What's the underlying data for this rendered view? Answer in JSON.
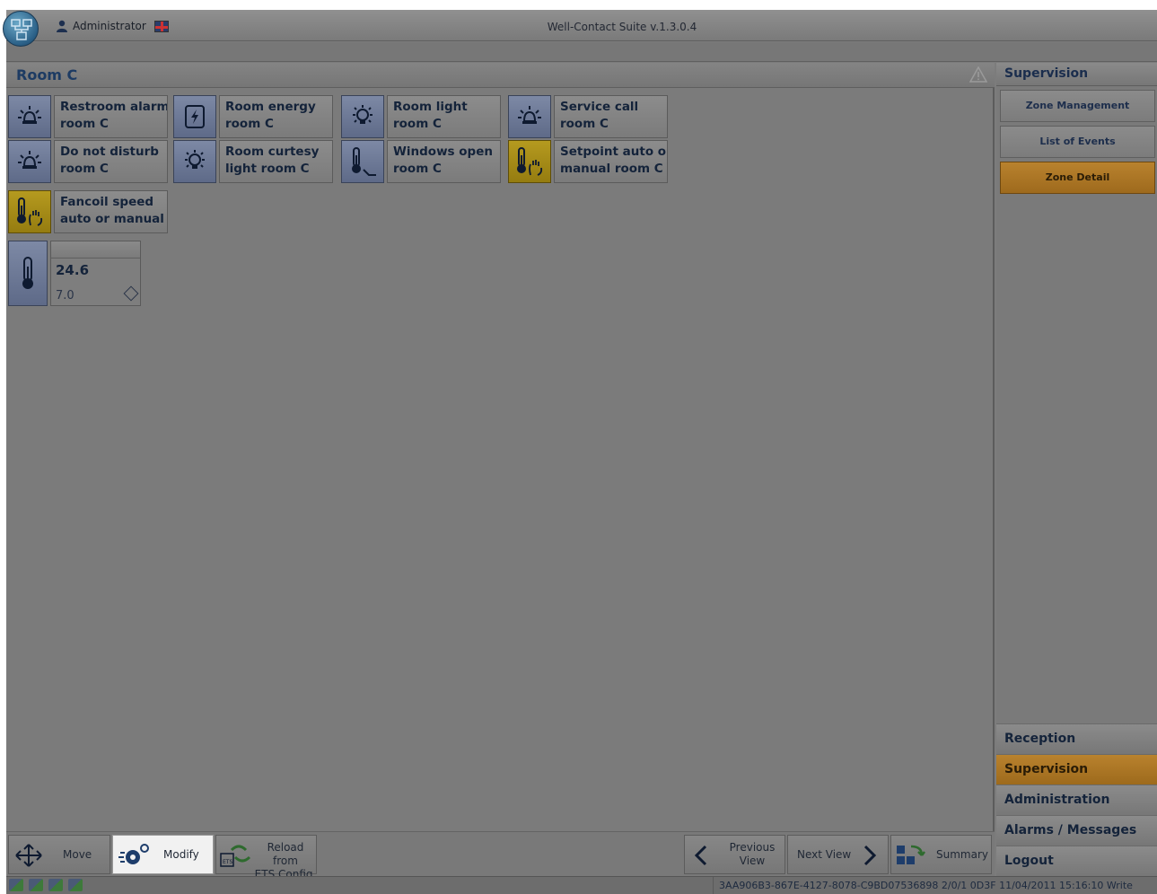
{
  "window": {
    "title": "Well-Contact Suite v.1.3.0.4",
    "user": "Administrator"
  },
  "room": {
    "title": "Room C"
  },
  "tiles": [
    {
      "line1": "Restroom alarm",
      "line2": "room C",
      "icon": "alarm-light-icon"
    },
    {
      "line1": "Room energy",
      "line2": "room C",
      "icon": "energy-icon"
    },
    {
      "line1": "Room light",
      "line2": "room C",
      "icon": "light-bulb-icon"
    },
    {
      "line1": "Service call",
      "line2": "room C",
      "icon": "alarm-light-icon"
    },
    {
      "line1": "Do not disturb",
      "line2": "room C",
      "icon": "alarm-light-icon"
    },
    {
      "line1": "Room curtesy",
      "line2": "light room C",
      "icon": "light-bulb-icon"
    },
    {
      "line1": "Windows open",
      "line2": "room C",
      "icon": "thermometer-window-icon"
    },
    {
      "line1": "Setpoint auto or",
      "line2": "manual room C",
      "icon": "thermometer-hand-icon"
    },
    {
      "line1": "Fancoil speed",
      "line2": "auto or manual",
      "icon": "thermometer-hand-icon"
    }
  ],
  "thermostat": {
    "temperature": "24.6",
    "setpoint": "7.0"
  },
  "toolbar": {
    "move": "Move",
    "modify": "Modify",
    "reload_line1": "Reload from",
    "reload_line2": "ETS Config.",
    "prev_line1": "Previous",
    "prev_line2": "View",
    "next": "Next View",
    "summary": "Summary"
  },
  "sidebar": {
    "header": "Supervision",
    "buttons": [
      "Zone Management",
      "List of Events",
      "Zone Detail"
    ],
    "active_button": "Zone Detail",
    "nav": [
      "Reception",
      "Supervision",
      "Administration",
      "Alarms / Messages",
      "Logout"
    ],
    "active_nav": "Supervision"
  },
  "status": {
    "info": "3AA906B3-867E-4127-8078-C9BD07536898 2/0/1 0D3F 11/04/2011 15:16:10 Write"
  },
  "colors": {
    "accent_orange": "#b9822e",
    "alert_yellow": "#b59a1f",
    "icon_blue": "#6e7a98",
    "text_navy": "#1d3b63"
  }
}
